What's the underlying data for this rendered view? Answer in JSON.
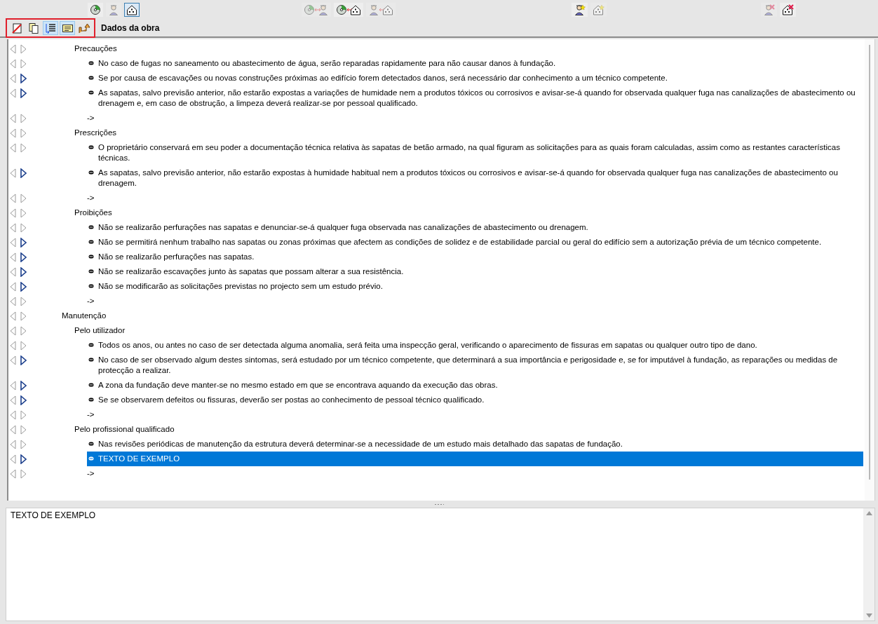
{
  "top_toolbar": [
    {
      "group": [
        {
          "kind": "disc",
          "disabled": false,
          "pressed": false
        },
        {
          "kind": "person",
          "disabled": true,
          "pressed": false
        },
        {
          "kind": "house",
          "disabled": false,
          "pressed": true
        }
      ]
    },
    {
      "group": [
        {
          "kind": "disc-person",
          "disabled": true,
          "pressed": false
        },
        {
          "kind": "disc-house",
          "disabled": false,
          "pressed": false
        },
        {
          "kind": "person-house",
          "disabled": true,
          "pressed": false
        }
      ]
    },
    {
      "group": [
        {
          "kind": "person-add",
          "disabled": false,
          "pressed": false
        },
        {
          "kind": "house-add",
          "disabled": true,
          "pressed": false
        }
      ]
    },
    {
      "group": [
        {
          "kind": "person-remove",
          "disabled": true,
          "pressed": false
        },
        {
          "kind": "house-remove",
          "disabled": false,
          "pressed": false
        }
      ]
    }
  ],
  "edit_toolbar": {
    "highlighted": true,
    "buttons": [
      {
        "kind": "clear",
        "pressed": false
      },
      {
        "kind": "copy",
        "pressed": false
      },
      {
        "kind": "list",
        "pressed": true
      },
      {
        "kind": "text",
        "pressed": true
      },
      {
        "kind": "up",
        "pressed": false
      }
    ]
  },
  "title": "Dados da obra",
  "outline": [
    {
      "kind": "section",
      "text": "Precauções",
      "marked": false,
      "selected": false,
      "children": [
        {
          "kind": "item",
          "text": "No caso de fugas no saneamento ou abastecimento de água, serão reparadas rapidamente para não causar danos à fundação.",
          "marked": false,
          "selected": false
        },
        {
          "kind": "item",
          "text": "Se por causa de escavações ou novas construções próximas ao edifício forem detectados danos, será necessário dar conhecimento a um técnico competente.",
          "marked": true,
          "selected": false
        },
        {
          "kind": "item",
          "text": "As sapatas, salvo previsão anterior, não estarão expostas a variações de humidade nem a produtos tóxicos ou corrosivos e avisar-se-á quando for observada qualquer fuga nas canalizações de abastecimento ou drenagem e, em caso de obstrução, a limpeza deverá realizar-se por pessoal qualificado.",
          "marked": true,
          "selected": false
        },
        {
          "kind": "end",
          "text": "->",
          "marked": false,
          "selected": false
        }
      ]
    },
    {
      "kind": "section",
      "text": "Prescrições",
      "marked": false,
      "selected": false,
      "children": [
        {
          "kind": "item",
          "text": "O proprietário conservará em seu poder a documentação técnica relativa às sapatas de betão armado, na qual figuram as solicitações para as quais foram calculadas, assim como as restantes características técnicas.",
          "marked": false,
          "selected": false
        },
        {
          "kind": "item",
          "text": "As sapatas, salvo previsão anterior, não estarão expostas à humidade habitual nem a produtos tóxicos ou corrosivos e avisar-se-á quando for observada qualquer fuga nas canalizações de abastecimento ou drenagem.",
          "marked": true,
          "selected": false
        },
        {
          "kind": "end",
          "text": "->",
          "marked": false,
          "selected": false
        }
      ]
    },
    {
      "kind": "section",
      "text": "Proibições",
      "marked": false,
      "selected": false,
      "children": [
        {
          "kind": "item",
          "text": "Não se realizarão perfurações nas sapatas e denunciar-se-á qualquer fuga observada nas canalizações de abastecimento ou drenagem.",
          "marked": false,
          "selected": false
        },
        {
          "kind": "item",
          "text": "Não se permitirá nenhum trabalho nas sapatas ou zonas próximas que afectem as condições de solidez e de estabilidade parcial ou geral do edifício sem a autorização prévia de um técnico competente.",
          "marked": true,
          "selected": false
        },
        {
          "kind": "item",
          "text": "Não se realizarão perfurações nas sapatas.",
          "marked": true,
          "selected": false
        },
        {
          "kind": "item",
          "text": "Não se realizarão escavações junto às sapatas que possam alterar a sua resistência.",
          "marked": true,
          "selected": false
        },
        {
          "kind": "item",
          "text": "Não se modificarão as solicitações previstas no projecto sem um estudo prévio.",
          "marked": true,
          "selected": false
        },
        {
          "kind": "end",
          "text": "->",
          "marked": false,
          "selected": false
        }
      ]
    },
    {
      "kind": "chapter",
      "text": "Manutenção",
      "marked": false,
      "selected": false,
      "children": [
        {
          "kind": "section",
          "text": "Pelo utilizador",
          "marked": false,
          "selected": false,
          "children": [
            {
              "kind": "item",
              "text": "Todos os anos, ou antes no caso de ser detectada alguma anomalia, será feita uma inspecção geral, verificando o aparecimento de fissuras em sapatas ou qualquer outro tipo de dano.",
              "marked": false,
              "selected": false
            },
            {
              "kind": "item",
              "text": "No caso de ser observado algum destes sintomas, será estudado por um técnico competente, que determinará a sua importância e perigosidade e, se for imputável à fundação, as reparações ou medidas de protecção a realizar.",
              "marked": true,
              "selected": false
            },
            {
              "kind": "item",
              "text": "A zona da fundação deve manter-se no mesmo estado em que se encontrava aquando da execução das obras.",
              "marked": true,
              "selected": false
            },
            {
              "kind": "item",
              "text": "Se se observarem defeitos ou fissuras, deverão ser postas ao conhecimento de pessoal técnico qualificado.",
              "marked": true,
              "selected": false
            },
            {
              "kind": "end",
              "text": "->",
              "marked": false,
              "selected": false
            }
          ]
        },
        {
          "kind": "section",
          "text": "Pelo profissional qualificado",
          "marked": false,
          "selected": false,
          "children": [
            {
              "kind": "item",
              "text": "Nas revisões periódicas de manutenção da estrutura deverá determinar-se a necessidade de um estudo mais detalhado das sapatas de fundação.",
              "marked": false,
              "selected": false
            },
            {
              "kind": "item",
              "text": "TEXTO DE EXEMPLO",
              "marked": true,
              "selected": true
            },
            {
              "kind": "end",
              "text": "->",
              "marked": false,
              "selected": false
            }
          ]
        }
      ]
    }
  ],
  "editor": {
    "value": "TEXTO DE EXEMPLO"
  }
}
